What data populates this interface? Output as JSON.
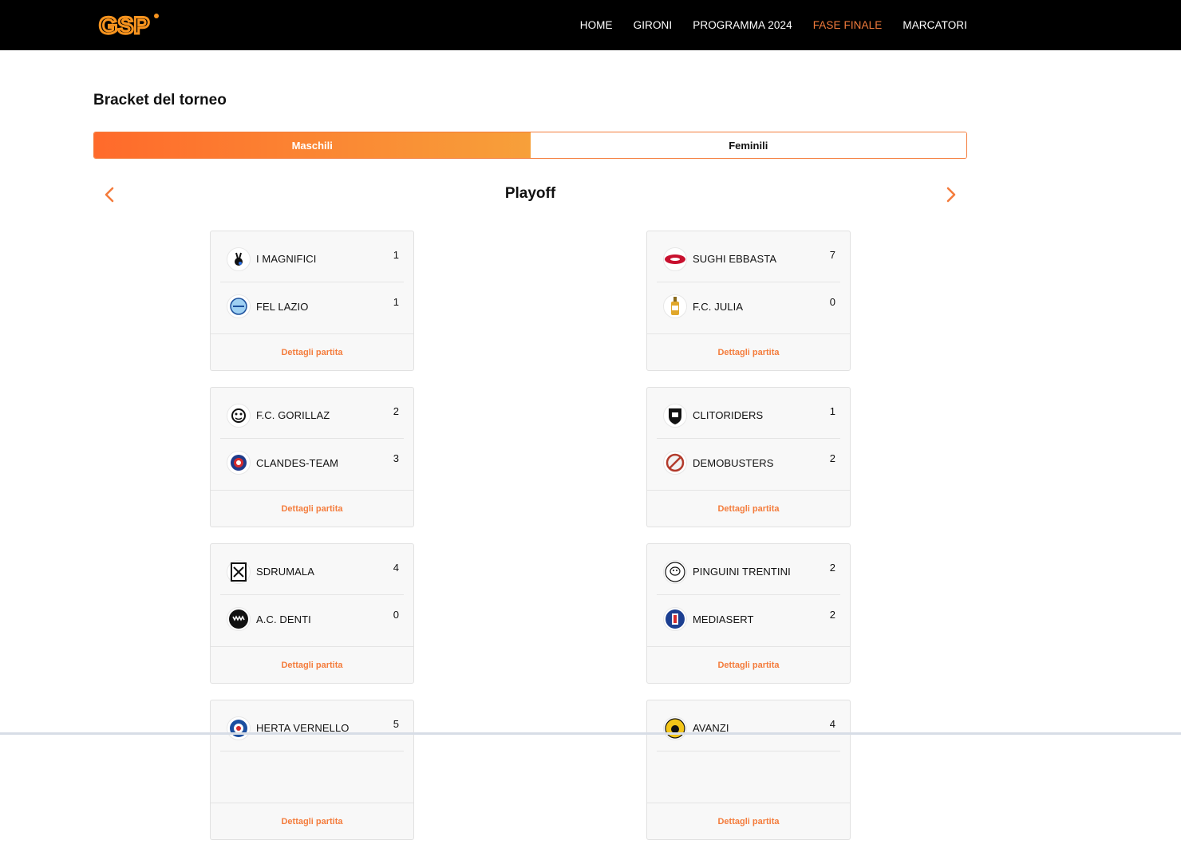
{
  "nav": {
    "logo_text": "GSP",
    "links": [
      {
        "label": "HOME",
        "active": false
      },
      {
        "label": "GIRONI",
        "active": false
      },
      {
        "label": "PROGRAMMA 2024",
        "active": false
      },
      {
        "label": "FASE FINALE",
        "active": true
      },
      {
        "label": "MARCATORI",
        "active": false
      }
    ]
  },
  "page": {
    "title": "Bracket del torneo",
    "tabs": [
      {
        "label": "Maschili",
        "active": true
      },
      {
        "label": "Feminili",
        "active": false
      }
    ],
    "round_title": "Playoff",
    "details_label": "Dettagli partita"
  },
  "matches": {
    "left": [
      {
        "team1": "I MAGNIFICI",
        "score1": "1",
        "icon1": "bunny-icon",
        "team2": "FEL LAZIO",
        "score2": "1",
        "icon2": "eagle-shield-icon"
      },
      {
        "team1": "F.C. GORILLAZ",
        "score1": "2",
        "icon1": "gorilla-icon",
        "team2": "CLANDES-TEAM",
        "score2": "3",
        "icon2": "ball-crest-icon"
      },
      {
        "team1": "SDRUMALA",
        "score1": "4",
        "icon1": "square-crest-icon",
        "team2": "A.C. DENTI",
        "score2": "0",
        "icon2": "teeth-icon"
      },
      {
        "team1": "HERTA VERNELLO",
        "score1": "5",
        "icon1": "herta-crest-icon",
        "team2": "",
        "score2": "",
        "icon2": ""
      }
    ],
    "right": [
      {
        "team1": "SUGHI EBBASTA",
        "score1": "7",
        "icon1": "sughi-logo-icon",
        "team2": "F.C. JULIA",
        "score2": "0",
        "icon2": "bottle-icon"
      },
      {
        "team1": "CLITORIDERS",
        "score1": "1",
        "icon1": "shield-crest-icon",
        "team2": "DEMOBUSTERS",
        "score2": "2",
        "icon2": "no-ghost-icon"
      },
      {
        "team1": "PINGUINI TRENTINI",
        "score1": "2",
        "icon1": "penguin-icon",
        "team2": "MEDIASERT",
        "score2": "2",
        "icon2": "mediasert-crest-icon"
      },
      {
        "team1": "AVANZI",
        "score1": "4",
        "icon1": "avanzi-crest-icon",
        "team2": "",
        "score2": "",
        "icon2": ""
      }
    ]
  },
  "colors": {
    "accent": "#f47c3c",
    "navbar": "#000000",
    "card_bg": "#f8f8f8"
  }
}
